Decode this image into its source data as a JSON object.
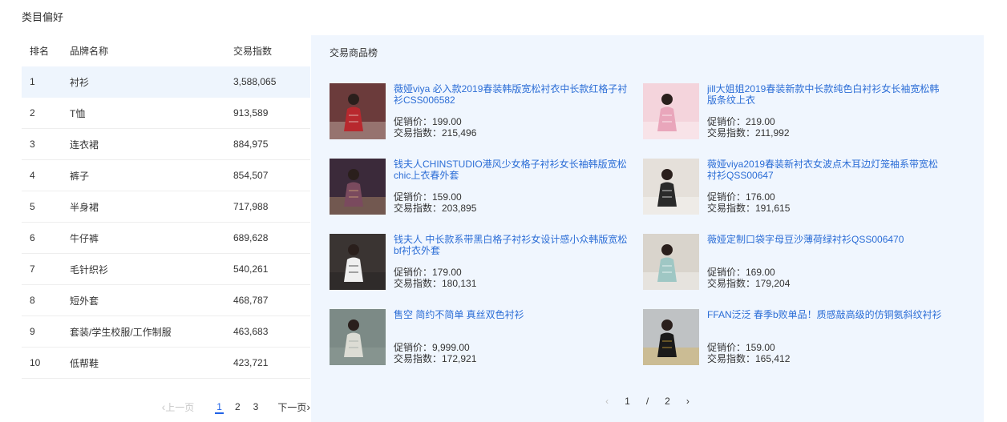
{
  "section_title": "类目偏好",
  "rank_table": {
    "headers": {
      "rank": "排名",
      "brand": "品牌名称",
      "index": "交易指数"
    },
    "rows": [
      {
        "rank": "1",
        "name": "衬衫",
        "index": "3,588,065"
      },
      {
        "rank": "2",
        "name": "T恤",
        "index": "913,589"
      },
      {
        "rank": "3",
        "name": "连衣裙",
        "index": "884,975"
      },
      {
        "rank": "4",
        "name": "裤子",
        "index": "854,507"
      },
      {
        "rank": "5",
        "name": "半身裙",
        "index": "717,988"
      },
      {
        "rank": "6",
        "name": "牛仔裤",
        "index": "689,628"
      },
      {
        "rank": "7",
        "name": "毛针织衫",
        "index": "540,261"
      },
      {
        "rank": "8",
        "name": "短外套",
        "index": "468,787"
      },
      {
        "rank": "9",
        "name": "套装/学生校服/工作制服",
        "index": "463,683"
      },
      {
        "rank": "10",
        "name": "低帮鞋",
        "index": "423,721"
      }
    ],
    "pager": {
      "prev": "上一页",
      "pages": [
        "1",
        "2",
        "3"
      ],
      "current": "1",
      "next": "下一页"
    }
  },
  "products": {
    "title": "交易商品榜",
    "items": [
      {
        "name": "薇娅viya 必入款2019春装韩版宽松衬衣中长款红格子衬衫CSS006582",
        "price": "促销价：199.00",
        "trade": "交易指数：215,496"
      },
      {
        "name": "jill大姐姐2019春装新款中长款纯色白衬衫女长袖宽松韩版条纹上衣",
        "price": "促销价：219.00",
        "trade": "交易指数：211,992"
      },
      {
        "name": "钱夫人CHINSTUDIO港风少女格子衬衫女长袖韩版宽松chic上衣春外套",
        "price": "促销价：159.00",
        "trade": "交易指数：203,895"
      },
      {
        "name": "薇娅viya2019春装新衬衣女波点木耳边灯笼袖系带宽松衬衫QSS00647",
        "price": "促销价：176.00",
        "trade": "交易指数：191,615"
      },
      {
        "name": "钱夫人 中长款系带黑白格子衬衫女设计感小众韩版宽松bf衬衣外套",
        "price": "促销价：179.00",
        "trade": "交易指数：180,131"
      },
      {
        "name": "薇娅定制口袋字母豆沙薄荷绿衬衫QSS006470",
        "price": "促销价：169.00",
        "trade": "交易指数：179,204"
      },
      {
        "name": "售空 简约不简单 真丝双色衬衫",
        "price": "促销价：9,999.00",
        "trade": "交易指数：172,921"
      },
      {
        "name": "FFAN泛泛 春季b败单品！质感敲高级的仿铜氨斜纹衬衫",
        "price": "促销价：159.00",
        "trade": "交易指数：165,412"
      }
    ],
    "pager": {
      "current": "1",
      "separator": "/",
      "total": "2"
    }
  }
}
